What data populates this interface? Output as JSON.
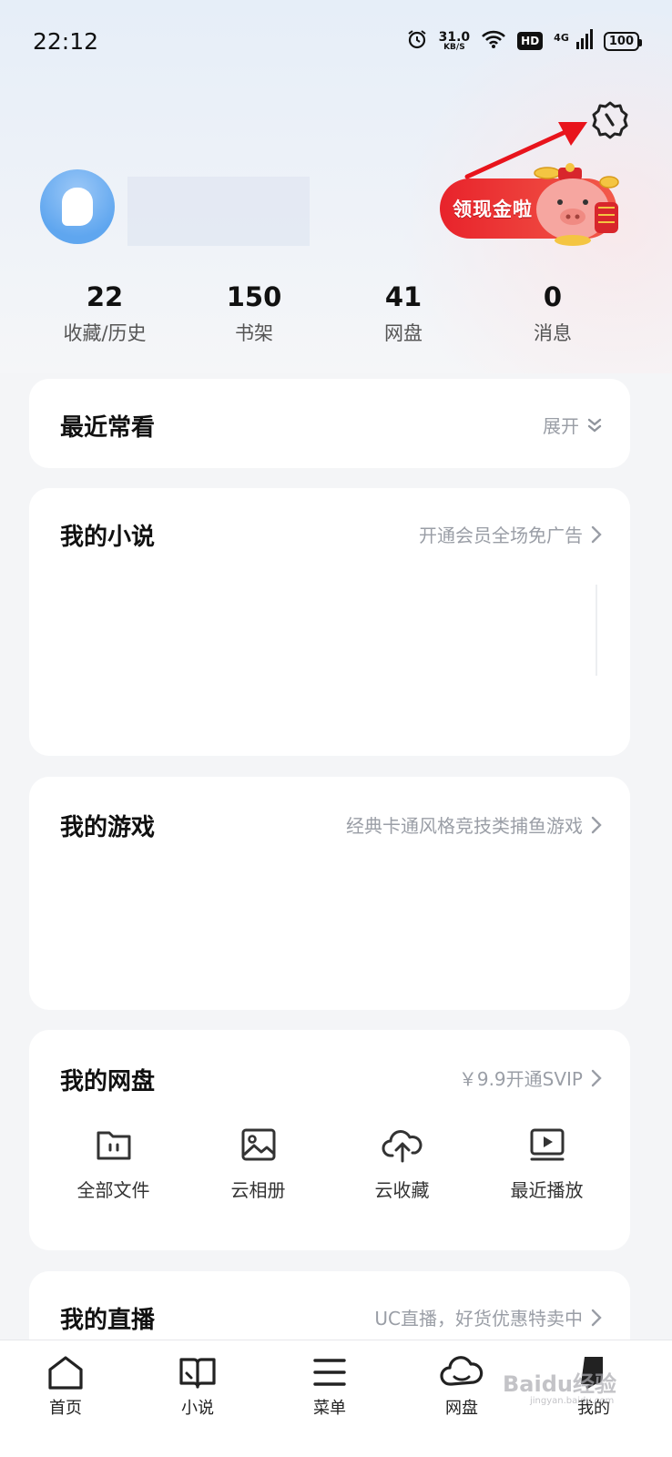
{
  "status_bar": {
    "time": "22:12",
    "net_speed_value": "31.0",
    "net_speed_unit": "KB/S",
    "hd": "HD",
    "network": "4G",
    "battery": "100"
  },
  "profile": {
    "promo_text": "领现金啦"
  },
  "stats": [
    {
      "value": "22",
      "label": "收藏/历史"
    },
    {
      "value": "150",
      "label": "书架"
    },
    {
      "value": "41",
      "label": "网盘"
    },
    {
      "value": "0",
      "label": "消息"
    }
  ],
  "cards": {
    "recent": {
      "title": "最近常看",
      "link": "展开"
    },
    "novel": {
      "title": "我的小说",
      "link": "开通会员全场免广告"
    },
    "game": {
      "title": "我的游戏",
      "link": "经典卡通风格竞技类捕鱼游戏"
    },
    "disk": {
      "title": "我的网盘",
      "link": "￥9.9开通SVIP",
      "items": [
        {
          "label": "全部文件",
          "icon": "folder-icon"
        },
        {
          "label": "云相册",
          "icon": "photo-album-icon"
        },
        {
          "label": "云收藏",
          "icon": "cloud-upload-icon"
        },
        {
          "label": "最近播放",
          "icon": "video-play-icon"
        }
      ]
    },
    "live": {
      "title": "我的直播",
      "link": "UC直播，好货优惠特卖中"
    }
  },
  "tabbar": [
    {
      "label": "首页",
      "icon": "home-icon"
    },
    {
      "label": "小说",
      "icon": "book-icon"
    },
    {
      "label": "菜单",
      "icon": "menu-icon"
    },
    {
      "label": "网盘",
      "icon": "cloud-icon"
    },
    {
      "label": "我的",
      "icon": "profile-icon"
    }
  ],
  "watermark": {
    "brand": "Baidu经验",
    "url": "jingyan.baidu.com"
  },
  "colors": {
    "accent_red": "#e8232b",
    "link_gray": "#9a9ea6",
    "avatar_blue": "#5fa6ef"
  }
}
